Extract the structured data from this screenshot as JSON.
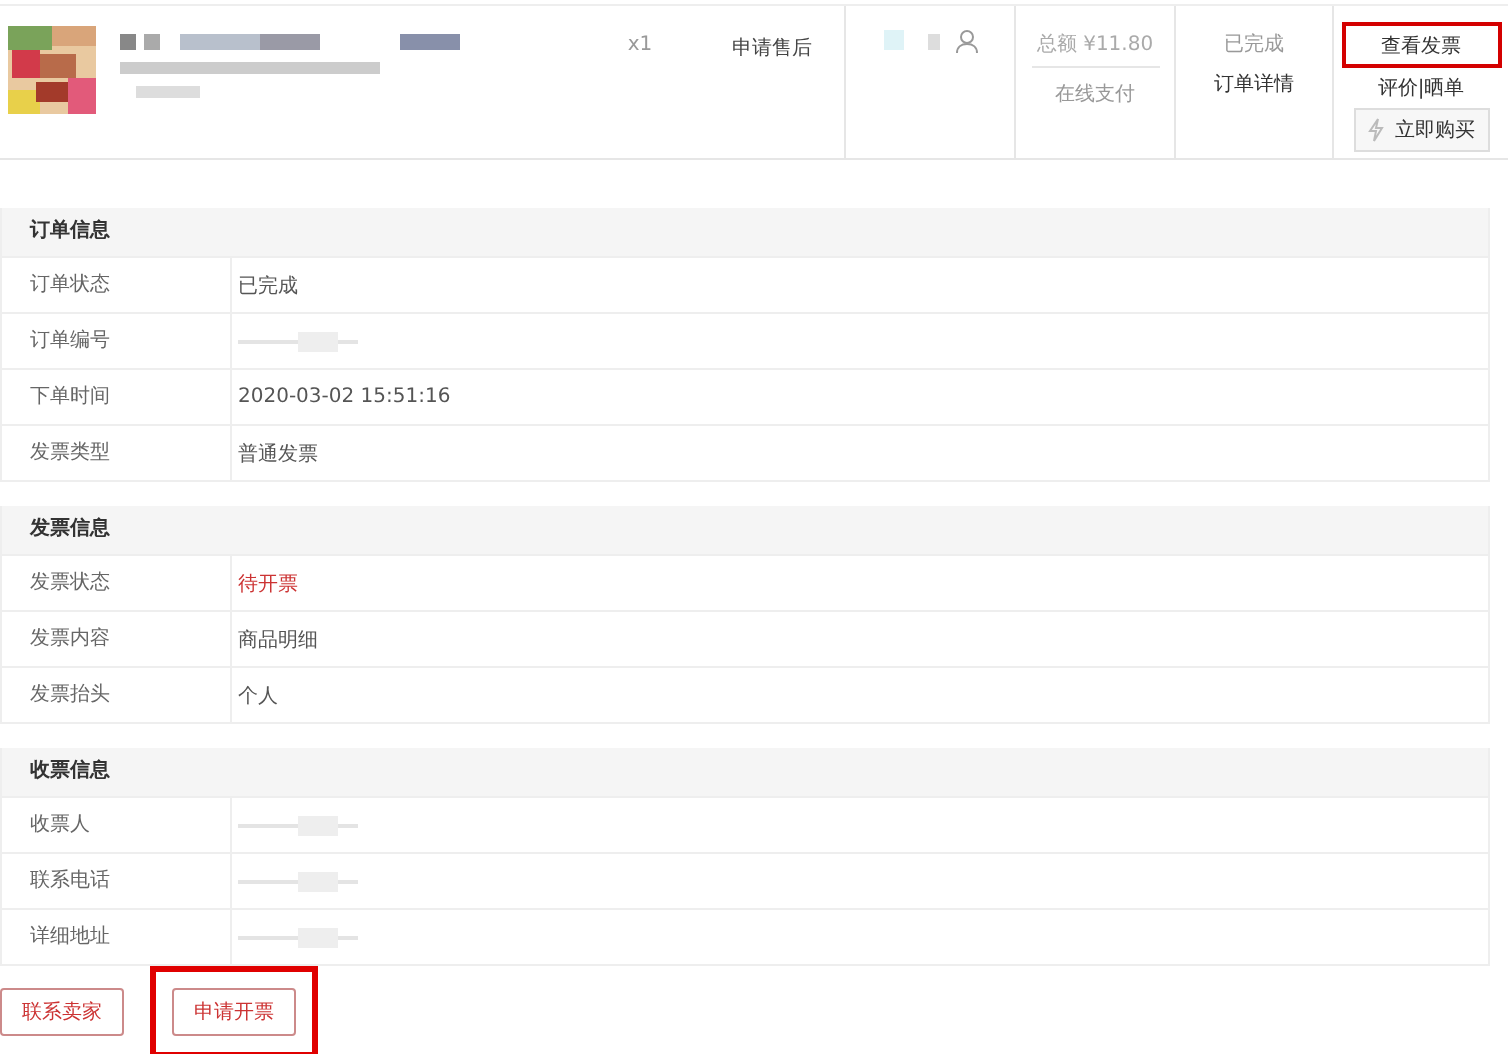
{
  "order_item": {
    "quantity": "x1",
    "after_sale_link": "申请售后",
    "price": "总额 ¥11.80",
    "payment": "在线支付",
    "status": "已完成",
    "details_link": "订单详情",
    "invoice_button": {
      "label": "查看发票",
      "highlighted": true
    },
    "review_link": "评价|晒单",
    "buy_button": "立即购买"
  },
  "sections": [
    {
      "title": "订单信息",
      "rows": [
        {
          "label": "订单状态",
          "kind": "text",
          "value": "已完成",
          "alert": false
        },
        {
          "label": "订单编号",
          "kind": "redacted"
        },
        {
          "label": "下单时间",
          "kind": "text",
          "value": "2020-03-02 15:51:16",
          "alert": false
        },
        {
          "label": "发票类型",
          "kind": "text",
          "value": "普通发票",
          "alert": false
        }
      ]
    },
    {
      "title": "发票信息",
      "rows": [
        {
          "label": "发票状态",
          "kind": "text",
          "value": "待开票",
          "alert": true
        },
        {
          "label": "发票内容",
          "kind": "text",
          "value": "商品明细",
          "alert": false
        },
        {
          "label": "发票抬头",
          "kind": "text",
          "value": "个人",
          "alert": false
        }
      ]
    },
    {
      "title": "收票信息",
      "rows": [
        {
          "label": "收票人",
          "kind": "redacted"
        },
        {
          "label": "联系电话",
          "kind": "redacted"
        },
        {
          "label": "详细地址",
          "kind": "redacted"
        }
      ]
    }
  ],
  "actions": [
    {
      "label": "联系卖家",
      "highlighted": false
    },
    {
      "label": "申请开票",
      "highlighted": true
    }
  ]
}
